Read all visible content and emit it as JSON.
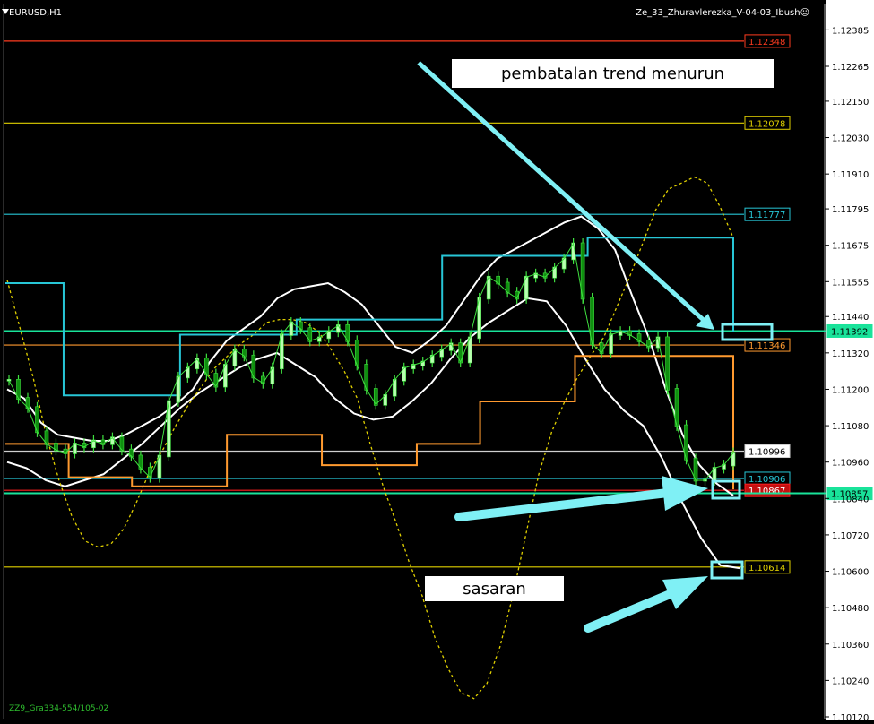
{
  "header": {
    "symbol": "EURUSD,H1",
    "indicator": "Ze_33_Zhuravlerezka_V-04-03_Ibush☺",
    "bottom_label": "ZZ9_Gra334-554/105-02"
  },
  "annotations": {
    "trend_cancel": "pembatalan trend menurun",
    "target": "sasaran"
  },
  "chart_data": {
    "type": "line",
    "title": "",
    "xlabel": "",
    "ylabel": "",
    "ylim": [
      1.1012,
      1.1246
    ],
    "y_ticks": [
      "1.12385",
      "1.12265",
      "1.12150",
      "1.12030",
      "1.11910",
      "1.11795",
      "1.11675",
      "1.11555",
      "1.11440",
      "1.11320",
      "1.11200",
      "1.11080",
      "1.10960",
      "1.10840",
      "1.10720",
      "1.10600",
      "1.10480",
      "1.10360",
      "1.10240",
      "1.10120"
    ],
    "levels": [
      {
        "label": "1.12348",
        "value": 1.12348,
        "color": "#ff3b1f"
      },
      {
        "label": "1.12078",
        "value": 1.12078,
        "color": "#e0d000"
      },
      {
        "label": "1.11777",
        "value": 1.11777,
        "color": "#27c6d6"
      },
      {
        "label": "1.11392",
        "value": 1.11392,
        "color": "#19e39a"
      },
      {
        "label": "1.11346",
        "value": 1.11346,
        "color": "#ff9a2f"
      },
      {
        "label": "1.10996",
        "value": 1.10996,
        "color": "#cfcfcf"
      },
      {
        "label": "1.10906",
        "value": 1.10906,
        "color": "#27c6d6"
      },
      {
        "label": "1.10867",
        "value": 1.10867,
        "color": "#ff2020"
      },
      {
        "label": "1.10857",
        "value": 1.10857,
        "color": "#19e39a"
      },
      {
        "label": "1.10614",
        "value": 1.10614,
        "color": "#e0d000"
      }
    ],
    "price": [
      1.1123,
      1.1117,
      1.1114,
      1.1106,
      1.1102,
      1.11,
      1.1099,
      1.1102,
      1.1101,
      1.1103,
      1.1102,
      1.1104,
      1.11,
      1.1098,
      1.1094,
      1.1091,
      1.1098,
      1.1116,
      1.1124,
      1.1127,
      1.113,
      1.1125,
      1.1121,
      1.1128,
      1.1133,
      1.1131,
      1.1124,
      1.1122,
      1.1127,
      1.1138,
      1.1142,
      1.114,
      1.1136,
      1.1137,
      1.1139,
      1.1141,
      1.1136,
      1.1128,
      1.112,
      1.1115,
      1.1118,
      1.1123,
      1.1127,
      1.1128,
      1.1129,
      1.1131,
      1.1133,
      1.1135,
      1.1129,
      1.1137,
      1.115,
      1.1157,
      1.1155,
      1.1152,
      1.115,
      1.1157,
      1.1158,
      1.1157,
      1.116,
      1.1163,
      1.1168,
      1.115,
      1.1135,
      1.1132,
      1.1138,
      1.1139,
      1.1138,
      1.1136,
      1.1134,
      1.1137,
      1.112,
      1.1108,
      1.1097,
      1.109,
      1.109,
      1.1094,
      1.1095,
      1.1099
    ],
    "series": [
      {
        "name": "",
        "color": "#ffffff",
        "values": [
          1.112,
          1.1117,
          1.1109,
          1.1105,
          1.1104,
          1.1103,
          1.1103,
          1.1105,
          1.1108,
          1.1111,
          1.1115,
          1.112,
          1.1129,
          1.1136,
          1.114,
          1.1144,
          1.115,
          1.1153,
          1.1154,
          1.1155,
          1.1152,
          1.1148,
          1.1141,
          1.1134,
          1.1132,
          1.1136,
          1.1141,
          1.1149,
          1.1157,
          1.1163,
          1.1166,
          1.1169,
          1.1172,
          1.1175,
          1.1177,
          1.1173,
          1.1166,
          1.1151,
          1.1137,
          1.112,
          1.1105,
          1.1095,
          1.1089,
          1.1085
        ]
      },
      {
        "name": "",
        "color": "#ffffff",
        "values": [
          1.1096,
          1.1094,
          1.109,
          1.1088,
          1.109,
          1.1092,
          1.1097,
          1.1102,
          1.1108,
          1.1114,
          1.1119,
          1.1123,
          1.1127,
          1.113,
          1.1132,
          1.1128,
          1.1124,
          1.1117,
          1.1112,
          1.111,
          1.1111,
          1.1116,
          1.1122,
          1.113,
          1.1137,
          1.1142,
          1.1146,
          1.115,
          1.1149,
          1.1141,
          1.113,
          1.112,
          1.1113,
          1.1108,
          1.1097,
          1.1083,
          1.1071,
          1.1062,
          1.1061
        ]
      },
      {
        "name": "",
        "color": "#e0d000",
        "values": [
          1.1156,
          1.114,
          1.1124,
          1.1105,
          1.109,
          1.1078,
          1.107,
          1.1068,
          1.1069,
          1.1074,
          1.1083,
          1.1093,
          1.11,
          1.1108,
          1.1115,
          1.1121,
          1.1127,
          1.1131,
          1.1135,
          1.1138,
          1.1142,
          1.1143,
          1.1143,
          1.1142,
          1.1139,
          1.1133,
          1.1126,
          1.1117,
          1.1102,
          1.1088,
          1.1076,
          1.1063,
          1.1052,
          1.1038,
          1.1028,
          1.102,
          1.1018,
          1.1023,
          1.1035,
          1.1052,
          1.1072,
          1.1092,
          1.1106,
          1.1116,
          1.1124,
          1.1131,
          1.1137,
          1.1147,
          1.1157,
          1.1168,
          1.1179,
          1.1186,
          1.1188,
          1.119,
          1.1188,
          1.118,
          1.117
        ]
      },
      {
        "name": "",
        "color": "#27c6d6",
        "values": [
          1.1155,
          1.1155,
          1.1118,
          1.1118,
          1.1118,
          1.1118,
          1.1138,
          1.1138,
          1.1138,
          1.1138,
          1.1143,
          1.1143,
          1.1143,
          1.1143,
          1.1143,
          1.1164,
          1.1164,
          1.1164,
          1.1164,
          1.1164,
          1.117,
          1.117,
          1.117,
          1.117,
          1.117,
          1.1139
        ]
      },
      {
        "name": "",
        "color": "#ff9a2f",
        "values": [
          1.1102,
          1.1102,
          1.1091,
          1.1091,
          1.1088,
          1.1088,
          1.1088,
          1.1105,
          1.1105,
          1.1105,
          1.1095,
          1.1095,
          1.1095,
          1.1102,
          1.1102,
          1.1116,
          1.1116,
          1.1116,
          1.1131,
          1.1131,
          1.1131,
          1.1131,
          1.1131,
          1.1087
        ]
      }
    ]
  }
}
